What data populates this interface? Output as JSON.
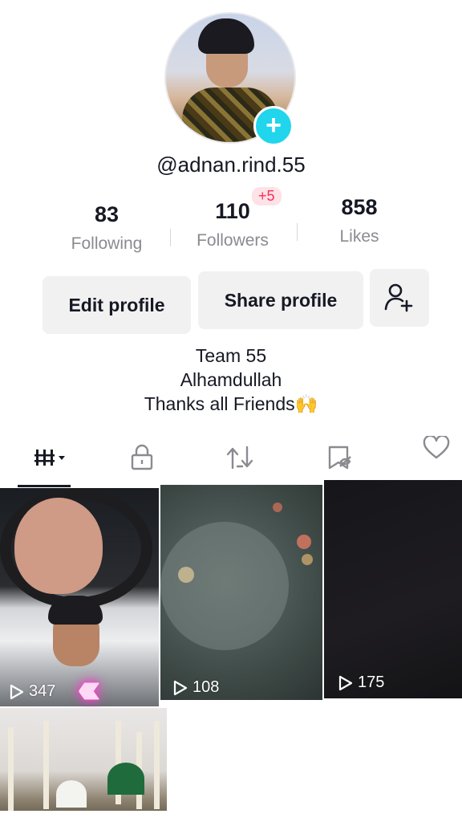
{
  "profile": {
    "username": "@adnan.rind.55",
    "bio_lines": [
      "Team 55",
      "Alhamdullah",
      "Thanks all Friends🙌"
    ]
  },
  "stats": [
    {
      "value": "83",
      "label": "Following"
    },
    {
      "value": "110",
      "label": "Followers",
      "badge": "+5"
    },
    {
      "value": "858",
      "label": "Likes"
    }
  ],
  "buttons": {
    "edit_profile": "Edit profile",
    "share_profile": "Share profile"
  },
  "tabs": [
    "videos-grid-icon",
    "lock-icon",
    "repost-icon",
    "saved-icon",
    "heart-icon"
  ],
  "videos": [
    {
      "views": "347"
    },
    {
      "views": "108"
    },
    {
      "views": "175"
    },
    {
      "views": ""
    }
  ],
  "colors": {
    "accent": "#20d5ec",
    "badge_text": "#fe2c55",
    "badge_bg": "#fde2e7",
    "button_bg": "#f1f1f2",
    "secondary_text": "#8a8b91"
  }
}
